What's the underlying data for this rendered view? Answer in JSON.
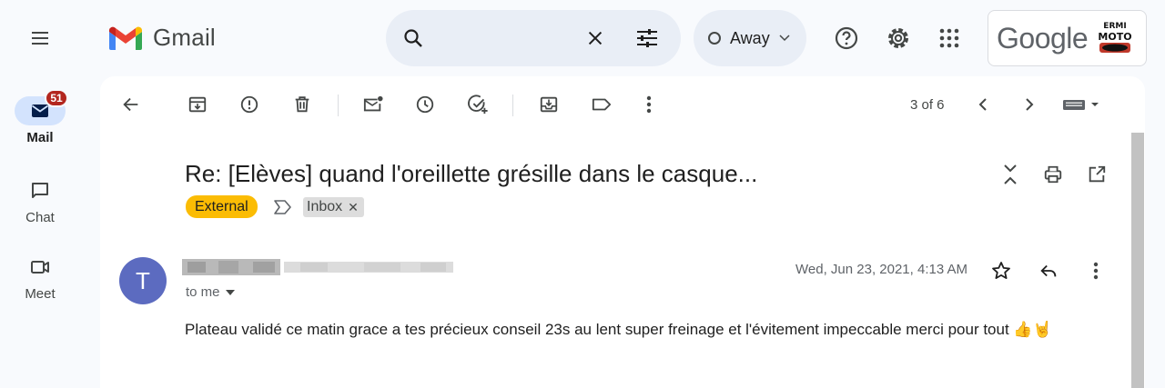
{
  "app": {
    "name": "Gmail"
  },
  "rail": {
    "items": [
      {
        "label": "Mail",
        "badge": "51",
        "icon": "mail-icon",
        "active": true
      },
      {
        "label": "Chat",
        "icon": "chat-icon"
      },
      {
        "label": "Meet",
        "icon": "video-icon"
      }
    ]
  },
  "status": {
    "label": "Away"
  },
  "account": {
    "google_label": "Google"
  },
  "toolbar": {
    "icons": [
      "back-arrow-icon",
      "archive-icon",
      "report-spam-icon",
      "delete-icon",
      "mark-unread-icon",
      "snooze-icon",
      "add-task-icon",
      "move-to-icon",
      "label-icon",
      "more-vert-icon"
    ],
    "pager": "3 of 6"
  },
  "email": {
    "subject": "Re: [Elèves] quand l'oreillette grésille dans le casque...",
    "labels": {
      "external": "External",
      "inbox": "Inbox"
    },
    "sender_initial": "T",
    "to": "to me",
    "date": "Wed, Jun 23, 2021, 4:13 AM",
    "body": "Plateau validé ce matin grace a tes précieux conseil 23s au lent super freinage et l'évitement impeccable merci pour tout 👍🤘"
  },
  "colors": {
    "accent": "#0b57d0",
    "external_chip": "#fbbc04",
    "badge": "#b3261e",
    "avatar": "#5c6bc0"
  }
}
